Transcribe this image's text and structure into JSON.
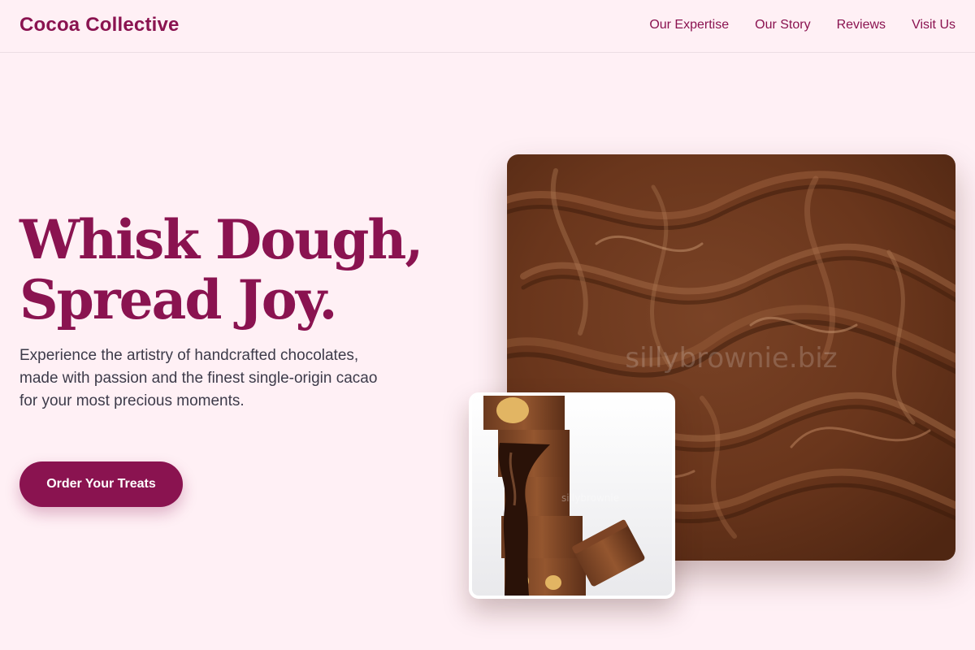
{
  "header": {
    "brand": "Cocoa Collective",
    "nav": [
      {
        "label": "Our Expertise"
      },
      {
        "label": "Our Story"
      },
      {
        "label": "Reviews"
      },
      {
        "label": "Visit Us"
      }
    ]
  },
  "hero": {
    "headline_line1": "Whisk Dough,",
    "headline_line2": "Spread Joy.",
    "description": "Experience the artistry of handcrafted chocolates, made with passion and the finest single-origin cacao for your most precious moments.",
    "cta_label": "Order Your Treats"
  },
  "images": {
    "main_alt": "Swirled chocolate spread",
    "main_watermark": "sillybrownie.biz",
    "secondary_alt": "Stacked chocolate peanut butter cups drizzled with chocolate",
    "secondary_watermark": "sillybrownie"
  },
  "colors": {
    "background": "#fff0f5",
    "brand": "#8a1350",
    "text": "#3d3b4a",
    "button_text": "#ffffff"
  }
}
